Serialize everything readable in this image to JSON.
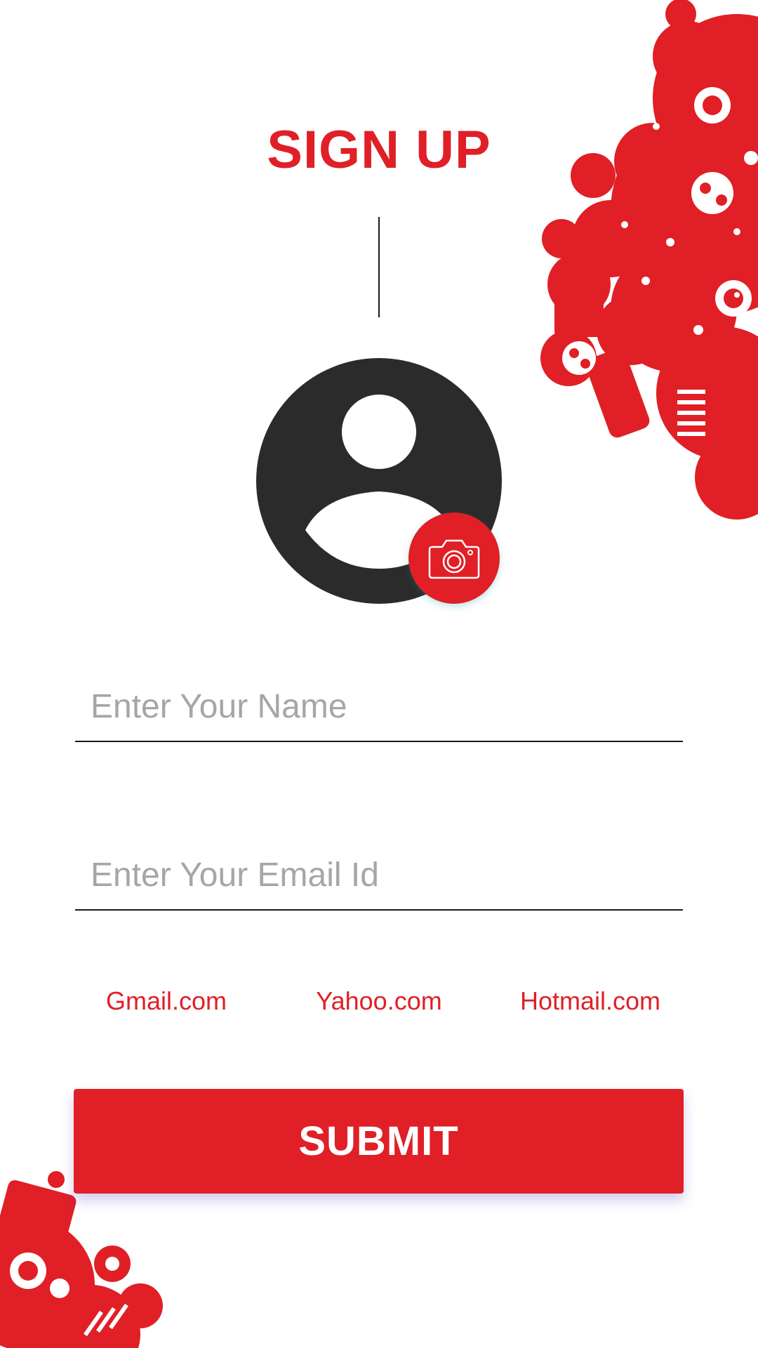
{
  "header": {
    "title": "SIGN UP"
  },
  "profile": {
    "avatar_icon": "user-silhouette-icon",
    "camera_icon": "camera-icon"
  },
  "form": {
    "name_placeholder": "Enter Your Name",
    "name_value": "",
    "email_placeholder": "Enter Your Email Id",
    "email_value": ""
  },
  "email_domains": [
    {
      "label": "Gmail.com"
    },
    {
      "label": "Yahoo.com"
    },
    {
      "label": "Hotmail.com"
    }
  ],
  "submit": {
    "label": "SUBMIT"
  },
  "colors": {
    "accent": "#e01f26",
    "avatar": "#2b2b2b",
    "placeholder": "#a6a6a6",
    "background": "#ffffff"
  }
}
